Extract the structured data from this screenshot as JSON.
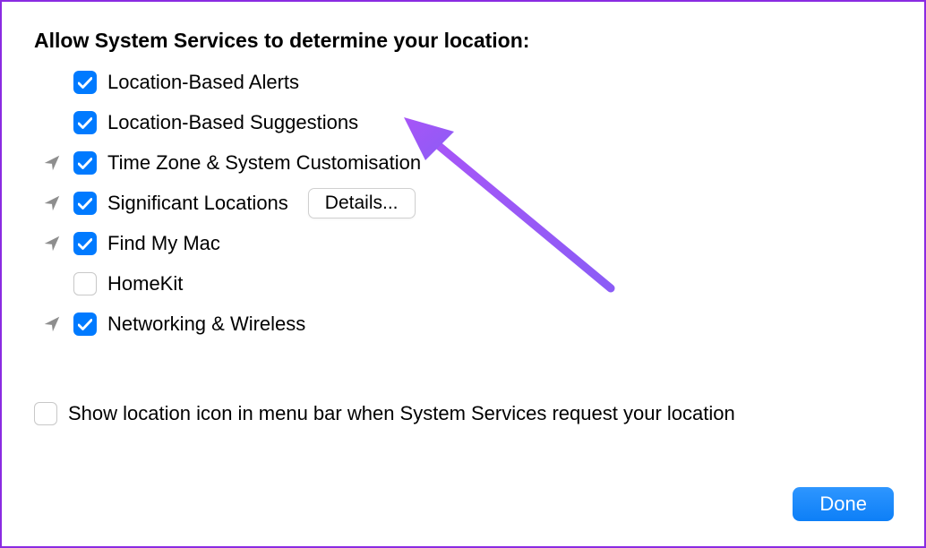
{
  "heading": "Allow System Services to determine your location:",
  "items": [
    {
      "label": "Location-Based Alerts",
      "checked": true,
      "hasArrow": false,
      "details": false
    },
    {
      "label": "Location-Based Suggestions",
      "checked": true,
      "hasArrow": false,
      "details": false
    },
    {
      "label": "Time Zone & System Customisation",
      "checked": true,
      "hasArrow": true,
      "details": false
    },
    {
      "label": "Significant Locations",
      "checked": true,
      "hasArrow": true,
      "details": true
    },
    {
      "label": "Find My Mac",
      "checked": true,
      "hasArrow": true,
      "details": false
    },
    {
      "label": "HomeKit",
      "checked": false,
      "hasArrow": false,
      "details": false
    },
    {
      "label": "Networking & Wireless",
      "checked": true,
      "hasArrow": true,
      "details": false
    }
  ],
  "detailsLabel": "Details...",
  "showLocation": {
    "label": "Show location icon in menu bar when System Services request your location",
    "checked": false
  },
  "doneLabel": "Done"
}
